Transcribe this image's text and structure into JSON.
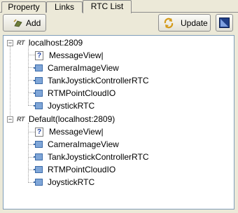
{
  "tabs": [
    {
      "label": "Property",
      "active": false
    },
    {
      "label": "Links",
      "active": false
    },
    {
      "label": "RTC List",
      "active": true
    }
  ],
  "toolbar": {
    "add_label": "Add",
    "update_label": "Update"
  },
  "tree": {
    "groups": [
      {
        "label": "localhost:2809",
        "badge": "RT",
        "expanded": true,
        "items": [
          {
            "label": "MessageView|",
            "icon": "question-icon"
          },
          {
            "label": "CameraImageView",
            "icon": "component-icon"
          },
          {
            "label": "TankJoystickControllerRTC",
            "icon": "component-icon"
          },
          {
            "label": "RTMPointCloudIO",
            "icon": "component-icon"
          },
          {
            "label": "JoystickRTC",
            "icon": "component-icon"
          }
        ]
      },
      {
        "label": "Default(localhost:2809)",
        "badge": "RT",
        "expanded": true,
        "items": [
          {
            "label": "MessageView|",
            "icon": "question-icon"
          },
          {
            "label": "CameraImageView",
            "icon": "component-icon"
          },
          {
            "label": "TankJoystickControllerRTC",
            "icon": "component-icon"
          },
          {
            "label": "RTMPointCloudIO",
            "icon": "component-icon"
          },
          {
            "label": "JoystickRTC",
            "icon": "component-icon"
          }
        ]
      }
    ]
  }
}
